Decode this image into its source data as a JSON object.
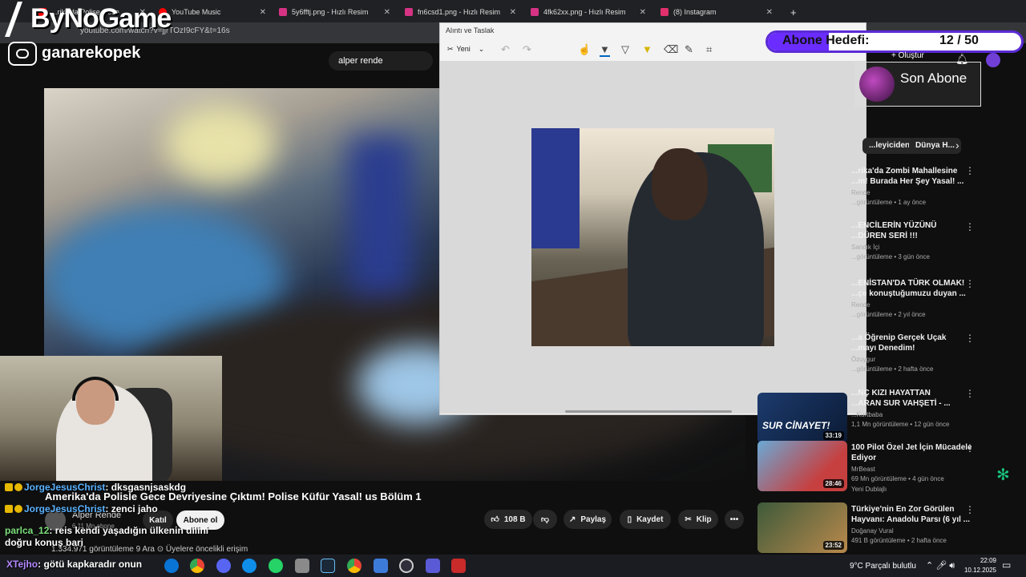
{
  "browser": {
    "tabs": [
      {
        "label": "...rika'da Polise Gece ...",
        "color": "#ff0000"
      },
      {
        "label": "YouTube Music",
        "color": "#ff0000"
      },
      {
        "label": "5y6fftj.png - Hızlı Resim",
        "color": "#d63384"
      },
      {
        "label": "fn6csd1.png - Hızlı Resim",
        "color": "#d63384"
      },
      {
        "label": "4fk62xx.png - Hızlı Resim",
        "color": "#d63384"
      },
      {
        "label": "(8) Instagram",
        "color": "#e1306c"
      }
    ],
    "url": "youtube.com/watch?v=jjrTOzI9cFY&t=16s",
    "new_tab": "+"
  },
  "overlay": {
    "logo": "ByNoGame",
    "instagram_handle": "ganarekopek",
    "abone_label": "Abone Hedefi:",
    "abone_count": "12 / 50",
    "abone_progress": 0.24,
    "son_abone_label": "Son Abone"
  },
  "youtube": {
    "search_chip": "alper rende",
    "create_label": "+ Oluştur",
    "video_title": "Amerika'da Polisle Gece Devriyesine Çıktım! Polise Küfür Yasal! us Bölüm 1",
    "channel_name": "Alper Rende",
    "channel_subs": "6,11 Mn abone",
    "join_label": "Katıl",
    "subscribe_label": "Abone ol",
    "like_count": "108 B",
    "share_label": "Paylaş",
    "save_label": "Kaydet",
    "clip_label": "Klip",
    "more_label": "•••",
    "views": "1.334.971 görüntüleme  9 Ara  ⊙ Üyelere öncelikli erişim"
  },
  "chat": [
    {
      "user": "JorgeJesusChrist",
      "text": ": dksgasnjsaskdg"
    },
    {
      "user": "JorgeJesusChrist",
      "text": ": zenci jaho"
    },
    {
      "user": "parlca_12",
      "text": ": reis kendi yaşadığın ülkenin dilini doğru konuş bari"
    },
    {
      "user": "XTejho",
      "text": ": götü kapkaradır onun"
    }
  ],
  "snip": {
    "title": "Alıntı ve Taslak",
    "new_label": "Yeni"
  },
  "sidebar": {
    "chips": [
      "...leyiciden",
      "Dünya H..."
    ],
    "items": [
      {
        "title": "...rika'da Zombi Mahallesine",
        "title2": "...m! Burada Her Şey Yasal! ...",
        "channel": "Rende",
        "meta": "...görüntüleme • 1 ay önce"
      },
      {
        "title": "...ENCİLERİN YÜZÜNÜ",
        "title2": "...DÜREN SERİ !!!",
        "channel": "Sandık İçi",
        "meta": "...görüntüleme • 3 gün önce"
      },
      {
        "title": "...ENİSTAN'DA TÜRK OLMAK!",
        "title2": "...çe konuştuğumuzu duyan ...",
        "channel": "Rende",
        "meta": "...görüntüleme • 2 yıl önce"
      },
      {
        "title": "...a Öğrenip Gerçek Uçak",
        "title2": "...mayı Denedim!",
        "channel": "Özuygur",
        "meta": "...görüntüleme • 2 hafta önce"
      },
      {
        "title": "...NÇ KIZI HAYATTAN",
        "title2": "...ARAN SUR VAHŞETİ - ...",
        "channel": "...Kurtbaba",
        "meta": "1,1 Mn görüntüleme • 12 gün önce"
      },
      {
        "title": "100 Pilot Özel Jet İçin Mücadele",
        "title2": "Ediyor",
        "channel": "MrBeast",
        "meta": "69 Mn görüntüleme • 4 gün önce"
      },
      {
        "title": "Türkiye'nin En Zor Görülen",
        "title2": "Hayvanı: Anadolu Parsı (6 yıl ...",
        "channel": "Doğanay Vural",
        "meta": "491 B görüntüleme • 2 hafta önce"
      }
    ],
    "thumb1_text": "SUR CİNAYET!",
    "durations": [
      "33:19",
      "28:46",
      "23:52"
    ],
    "tags": "Yeni   Dublajlı"
  },
  "taskbar": {
    "weather": "9°C  Parçalı bulutlu",
    "time": "22:09",
    "date": "10.12.2025"
  }
}
